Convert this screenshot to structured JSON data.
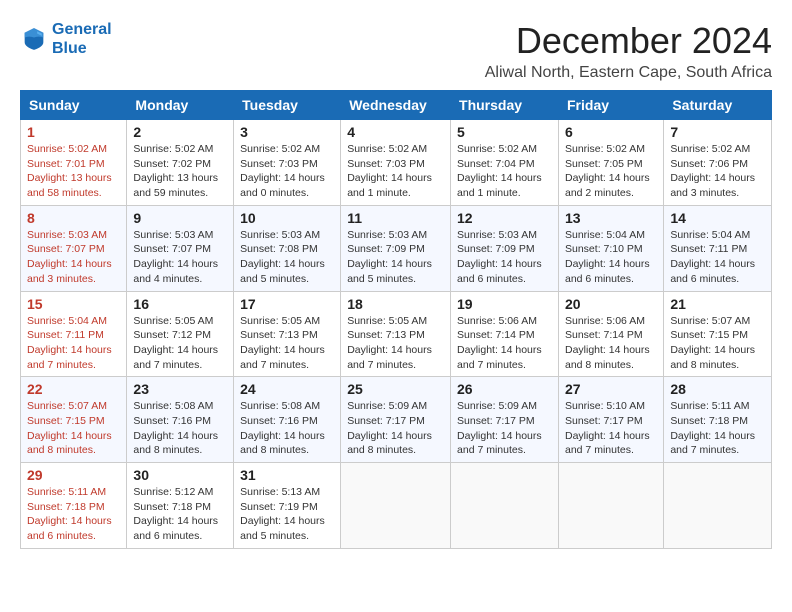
{
  "logo": {
    "line1": "General",
    "line2": "Blue"
  },
  "title": "December 2024",
  "location": "Aliwal North, Eastern Cape, South Africa",
  "headers": [
    "Sunday",
    "Monday",
    "Tuesday",
    "Wednesday",
    "Thursday",
    "Friday",
    "Saturday"
  ],
  "weeks": [
    [
      {
        "day": "1",
        "content": "Sunrise: 5:02 AM\nSunset: 7:01 PM\nDaylight: 13 hours\nand 58 minutes."
      },
      {
        "day": "2",
        "content": "Sunrise: 5:02 AM\nSunset: 7:02 PM\nDaylight: 13 hours\nand 59 minutes."
      },
      {
        "day": "3",
        "content": "Sunrise: 5:02 AM\nSunset: 7:03 PM\nDaylight: 14 hours\nand 0 minutes."
      },
      {
        "day": "4",
        "content": "Sunrise: 5:02 AM\nSunset: 7:03 PM\nDaylight: 14 hours\nand 1 minute."
      },
      {
        "day": "5",
        "content": "Sunrise: 5:02 AM\nSunset: 7:04 PM\nDaylight: 14 hours\nand 1 minute."
      },
      {
        "day": "6",
        "content": "Sunrise: 5:02 AM\nSunset: 7:05 PM\nDaylight: 14 hours\nand 2 minutes."
      },
      {
        "day": "7",
        "content": "Sunrise: 5:02 AM\nSunset: 7:06 PM\nDaylight: 14 hours\nand 3 minutes."
      }
    ],
    [
      {
        "day": "8",
        "content": "Sunrise: 5:03 AM\nSunset: 7:07 PM\nDaylight: 14 hours\nand 3 minutes."
      },
      {
        "day": "9",
        "content": "Sunrise: 5:03 AM\nSunset: 7:07 PM\nDaylight: 14 hours\nand 4 minutes."
      },
      {
        "day": "10",
        "content": "Sunrise: 5:03 AM\nSunset: 7:08 PM\nDaylight: 14 hours\nand 5 minutes."
      },
      {
        "day": "11",
        "content": "Sunrise: 5:03 AM\nSunset: 7:09 PM\nDaylight: 14 hours\nand 5 minutes."
      },
      {
        "day": "12",
        "content": "Sunrise: 5:03 AM\nSunset: 7:09 PM\nDaylight: 14 hours\nand 6 minutes."
      },
      {
        "day": "13",
        "content": "Sunrise: 5:04 AM\nSunset: 7:10 PM\nDaylight: 14 hours\nand 6 minutes."
      },
      {
        "day": "14",
        "content": "Sunrise: 5:04 AM\nSunset: 7:11 PM\nDaylight: 14 hours\nand 6 minutes."
      }
    ],
    [
      {
        "day": "15",
        "content": "Sunrise: 5:04 AM\nSunset: 7:11 PM\nDaylight: 14 hours\nand 7 minutes."
      },
      {
        "day": "16",
        "content": "Sunrise: 5:05 AM\nSunset: 7:12 PM\nDaylight: 14 hours\nand 7 minutes."
      },
      {
        "day": "17",
        "content": "Sunrise: 5:05 AM\nSunset: 7:13 PM\nDaylight: 14 hours\nand 7 minutes."
      },
      {
        "day": "18",
        "content": "Sunrise: 5:05 AM\nSunset: 7:13 PM\nDaylight: 14 hours\nand 7 minutes."
      },
      {
        "day": "19",
        "content": "Sunrise: 5:06 AM\nSunset: 7:14 PM\nDaylight: 14 hours\nand 7 minutes."
      },
      {
        "day": "20",
        "content": "Sunrise: 5:06 AM\nSunset: 7:14 PM\nDaylight: 14 hours\nand 8 minutes."
      },
      {
        "day": "21",
        "content": "Sunrise: 5:07 AM\nSunset: 7:15 PM\nDaylight: 14 hours\nand 8 minutes."
      }
    ],
    [
      {
        "day": "22",
        "content": "Sunrise: 5:07 AM\nSunset: 7:15 PM\nDaylight: 14 hours\nand 8 minutes."
      },
      {
        "day": "23",
        "content": "Sunrise: 5:08 AM\nSunset: 7:16 PM\nDaylight: 14 hours\nand 8 minutes."
      },
      {
        "day": "24",
        "content": "Sunrise: 5:08 AM\nSunset: 7:16 PM\nDaylight: 14 hours\nand 8 minutes."
      },
      {
        "day": "25",
        "content": "Sunrise: 5:09 AM\nSunset: 7:17 PM\nDaylight: 14 hours\nand 8 minutes."
      },
      {
        "day": "26",
        "content": "Sunrise: 5:09 AM\nSunset: 7:17 PM\nDaylight: 14 hours\nand 7 minutes."
      },
      {
        "day": "27",
        "content": "Sunrise: 5:10 AM\nSunset: 7:17 PM\nDaylight: 14 hours\nand 7 minutes."
      },
      {
        "day": "28",
        "content": "Sunrise: 5:11 AM\nSunset: 7:18 PM\nDaylight: 14 hours\nand 7 minutes."
      }
    ],
    [
      {
        "day": "29",
        "content": "Sunrise: 5:11 AM\nSunset: 7:18 PM\nDaylight: 14 hours\nand 6 minutes."
      },
      {
        "day": "30",
        "content": "Sunrise: 5:12 AM\nSunset: 7:18 PM\nDaylight: 14 hours\nand 6 minutes."
      },
      {
        "day": "31",
        "content": "Sunrise: 5:13 AM\nSunset: 7:19 PM\nDaylight: 14 hours\nand 5 minutes."
      },
      {
        "day": "",
        "content": ""
      },
      {
        "day": "",
        "content": ""
      },
      {
        "day": "",
        "content": ""
      },
      {
        "day": "",
        "content": ""
      }
    ]
  ]
}
